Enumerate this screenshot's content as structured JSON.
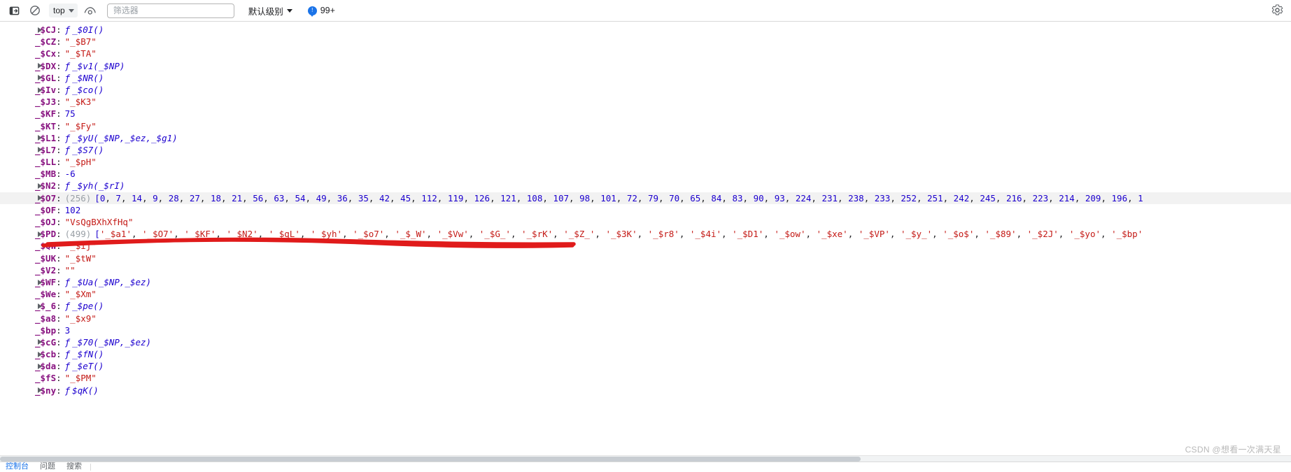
{
  "toolbar": {
    "context_label": "top",
    "filter_placeholder": "筛选器",
    "filter_value": "",
    "level_label": "默认级别",
    "issues_count": "99+",
    "icons": {
      "sidebar": "sidebar-toggle-icon",
      "clear": "clear-console-icon",
      "context_caret": "chevron-down-icon",
      "eye": "live-expression-icon",
      "level_caret": "chevron-down-icon",
      "issue_bubble": "issues-bubble-icon",
      "settings": "gear-icon"
    }
  },
  "console": {
    "rows": [
      {
        "expandable": true,
        "key": "_$CJ",
        "type": "function",
        "value": "_$0I()"
      },
      {
        "expandable": false,
        "key": "_$CZ",
        "type": "string",
        "value": "\"_$B7\""
      },
      {
        "expandable": false,
        "key": "_$Cx",
        "type": "string",
        "value": "\"_$TA\""
      },
      {
        "expandable": true,
        "key": "_$DX",
        "type": "function",
        "value": "_$v1(_$NP)"
      },
      {
        "expandable": true,
        "key": "_$GL",
        "type": "function",
        "value": "_$NR()"
      },
      {
        "expandable": true,
        "key": "_$Iv",
        "type": "function",
        "value": "_$co()"
      },
      {
        "expandable": false,
        "key": "_$J3",
        "type": "string",
        "value": "\"_$K3\""
      },
      {
        "expandable": false,
        "key": "_$KF",
        "type": "number",
        "value": "75"
      },
      {
        "expandable": false,
        "key": "_$KT",
        "type": "string",
        "value": "\"_$Fy\""
      },
      {
        "expandable": true,
        "key": "_$L1",
        "type": "function",
        "value": "_$yU(_$NP,_$ez,_$g1)"
      },
      {
        "expandable": true,
        "key": "_$L7",
        "type": "function",
        "value": "_$S7()"
      },
      {
        "expandable": false,
        "key": "_$LL",
        "type": "string",
        "value": "\"_$pH\""
      },
      {
        "expandable": false,
        "key": "_$MB",
        "type": "number",
        "value": "-6"
      },
      {
        "expandable": true,
        "key": "_$N2",
        "type": "function",
        "value": "_$yh(_$rI)"
      },
      {
        "expandable": true,
        "key": "_$O7",
        "type": "array-number",
        "count": "(256)",
        "highlight": true,
        "items": [
          0,
          7,
          14,
          9,
          28,
          27,
          18,
          21,
          56,
          63,
          54,
          49,
          36,
          35,
          42,
          45,
          112,
          119,
          126,
          121,
          108,
          107,
          98,
          101,
          72,
          79,
          70,
          65,
          84,
          83,
          90,
          93,
          224,
          231,
          238,
          233,
          252,
          251,
          242,
          245,
          216,
          223,
          214,
          209,
          196,
          1
        ]
      },
      {
        "expandable": false,
        "key": "_$OF",
        "type": "number",
        "value": "102"
      },
      {
        "expandable": false,
        "key": "_$OJ",
        "type": "string",
        "value": "\"VsQgBXhXfHq\""
      },
      {
        "expandable": true,
        "key": "_$PD",
        "type": "array-string",
        "count": "(499)",
        "items": [
          "_$a1",
          "_$O7",
          "_$KF",
          "_$N2",
          "_$qL",
          "_$yh",
          "_$o7",
          "_$_W",
          "_$Vw",
          "_$G_",
          "_$rK",
          "_$Z_",
          "_$3K",
          "_$r8",
          "_$4i",
          "_$D1",
          "_$ow",
          "_$xe",
          "_$VP",
          "_$y_",
          "_$o$",
          "_$89",
          "_$2J",
          "_$yo",
          "_$bp"
        ]
      },
      {
        "expandable": false,
        "key": "_$QW",
        "type": "string",
        "value": "\"_$ij\""
      },
      {
        "expandable": false,
        "key": "_$UK",
        "type": "string",
        "value": "\"_$tW\""
      },
      {
        "expandable": false,
        "key": "_$V2",
        "type": "string",
        "value": "\"\""
      },
      {
        "expandable": true,
        "key": "_$WF",
        "type": "function",
        "value": "_$Ua(_$NP,_$ez)"
      },
      {
        "expandable": false,
        "key": "_$We",
        "type": "string",
        "value": "\"_$Xm\""
      },
      {
        "expandable": true,
        "key": "_$_6",
        "type": "function",
        "value": "_$pe()"
      },
      {
        "expandable": false,
        "key": "_$a8",
        "type": "string",
        "value": "\"_$x9\""
      },
      {
        "expandable": false,
        "key": "_$bp",
        "type": "number",
        "value": "3"
      },
      {
        "expandable": true,
        "key": "_$cG",
        "type": "function",
        "value": "_$70(_$NP,_$ez)"
      },
      {
        "expandable": true,
        "key": "_$cb",
        "type": "function",
        "value": "_$fN()"
      },
      {
        "expandable": true,
        "key": "_$da",
        "type": "function",
        "value": "_$eT()"
      },
      {
        "expandable": false,
        "key": "_$fS",
        "type": "string",
        "value": "\"_$PM\""
      },
      {
        "expandable": true,
        "key": "_$ny",
        "type": "function",
        "value": "$qK()"
      }
    ]
  },
  "drawer": {
    "tabs": [
      "控制台",
      "问题",
      "搜索"
    ]
  },
  "watermark": "CSDN @想看一次满天星",
  "colors": {
    "key": "#881280",
    "string": "#c41a16",
    "number": "#1c00cf",
    "function": "#1c00cf",
    "count": "#9aa0a6",
    "annotation": "#e01b1b",
    "accent": "#1a73e8"
  }
}
